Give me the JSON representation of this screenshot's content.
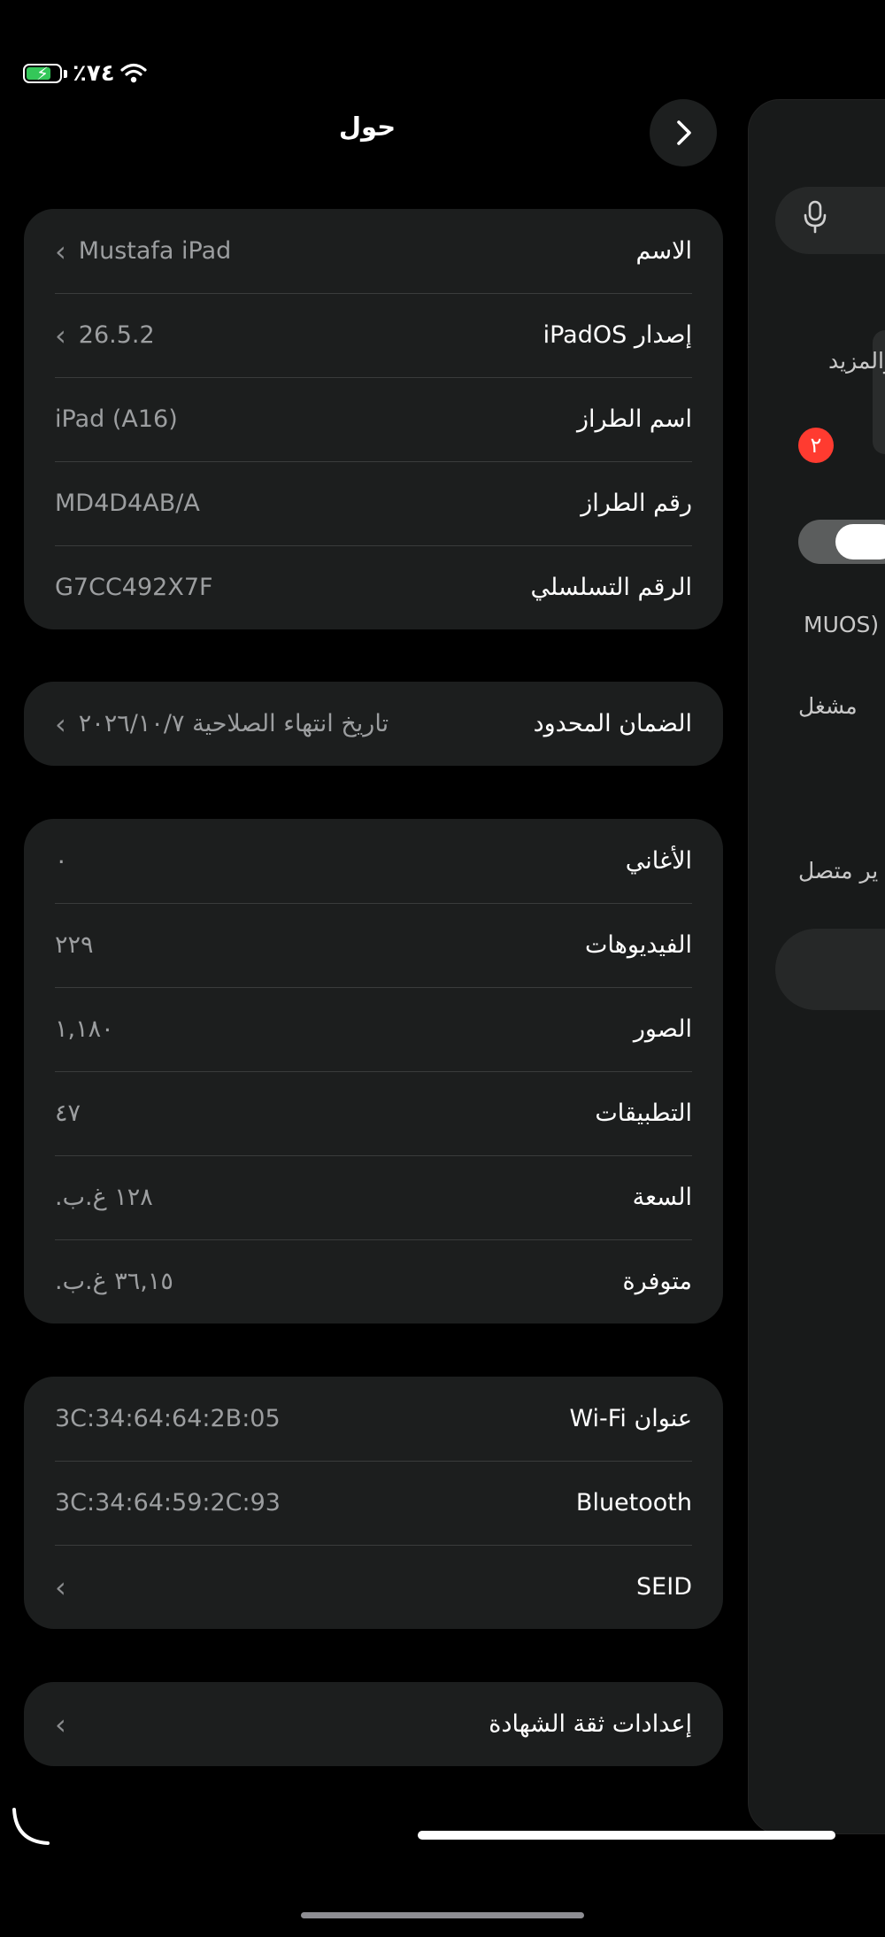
{
  "status_bar": {
    "battery_percent": "٪٧٤",
    "battery_level": 0.74,
    "charging": true
  },
  "nav": {
    "title": "حول"
  },
  "groups": {
    "device": [
      {
        "label": "الاسم",
        "value": "Mustafa iPad",
        "chevron": true
      },
      {
        "label": "إصدار iPadOS",
        "value": "26.5.2",
        "chevron": true
      },
      {
        "label": "اسم الطراز",
        "value": "iPad (A16)",
        "chevron": false
      },
      {
        "label": "رقم الطراز",
        "value": "MD4D4AB/A",
        "chevron": false
      },
      {
        "label": "الرقم التسلسلي",
        "value": "G7CC492X7F",
        "chevron": false
      }
    ],
    "warranty": [
      {
        "label": "الضمان المحدود",
        "value": "تاريخ انتهاء الصلاحية ٢٠٢٦/١٠/٧",
        "chevron": true
      }
    ],
    "content": [
      {
        "label": "الأغاني",
        "value": "٠",
        "chevron": false
      },
      {
        "label": "الفيديوهات",
        "value": "٢٢٩",
        "chevron": false
      },
      {
        "label": "الصور",
        "value": "١,١٨٠",
        "chevron": false
      },
      {
        "label": "التطبيقات",
        "value": "٤٧",
        "chevron": false
      },
      {
        "label": "السعة",
        "value": "١٢٨ غ.ب.",
        "chevron": false
      },
      {
        "label": "متوفرة",
        "value": "٣٦,١٥ غ.ب.",
        "chevron": false
      }
    ],
    "network": [
      {
        "label": "عنوان Wi-Fi",
        "value": "3C:34:64:64:2B:05",
        "chevron": false
      },
      {
        "label": "Bluetooth",
        "value": "3C:34:64:59:2C:93",
        "chevron": false
      },
      {
        "label": "SEID",
        "value": "",
        "chevron": true
      }
    ],
    "certificates": [
      {
        "label": "إعدادات ثقة الشهادة",
        "value": "",
        "chevron": true
      }
    ]
  },
  "right_panel": {
    "text_more": "والمزيد",
    "badge": "٢",
    "text_muos": "(MUOS",
    "text_on": "مشغل",
    "text_connected": "ير متصل"
  }
}
